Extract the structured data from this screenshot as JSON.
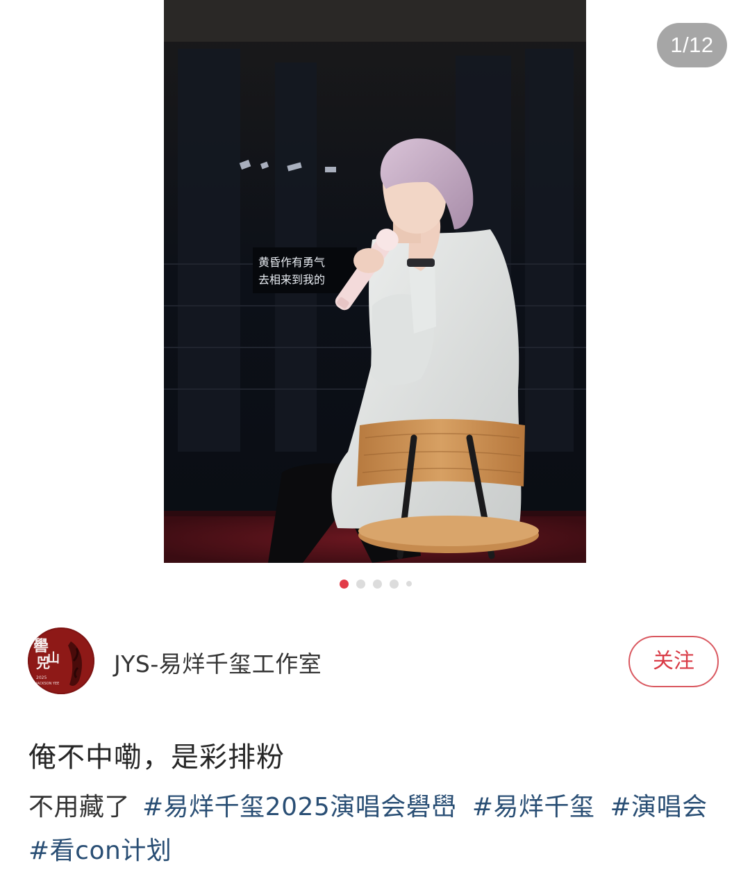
{
  "gallery": {
    "counter": "1/12",
    "photo_subtitle_line1": "黄昏作有勇气",
    "photo_subtitle_line2": "去相来到我的",
    "dots_total": 5,
    "dots_active_index": 0
  },
  "author": {
    "name": "JYS-易烊千玺工作室",
    "follow_label": "关注",
    "avatar_text": "嚳兕山"
  },
  "post": {
    "title": "俺不中嘞，是彩排粉",
    "body_text": "不用藏了",
    "hashtags": [
      "#易烊千玺2025演唱会礐嶨",
      "#易烊千玺",
      "#演唱会",
      "#看con计划"
    ]
  },
  "colors": {
    "accent_red": "#e23b48",
    "follow_border": "#d9575f",
    "hashtag_blue": "#294e74",
    "counter_bg": "#969696"
  }
}
